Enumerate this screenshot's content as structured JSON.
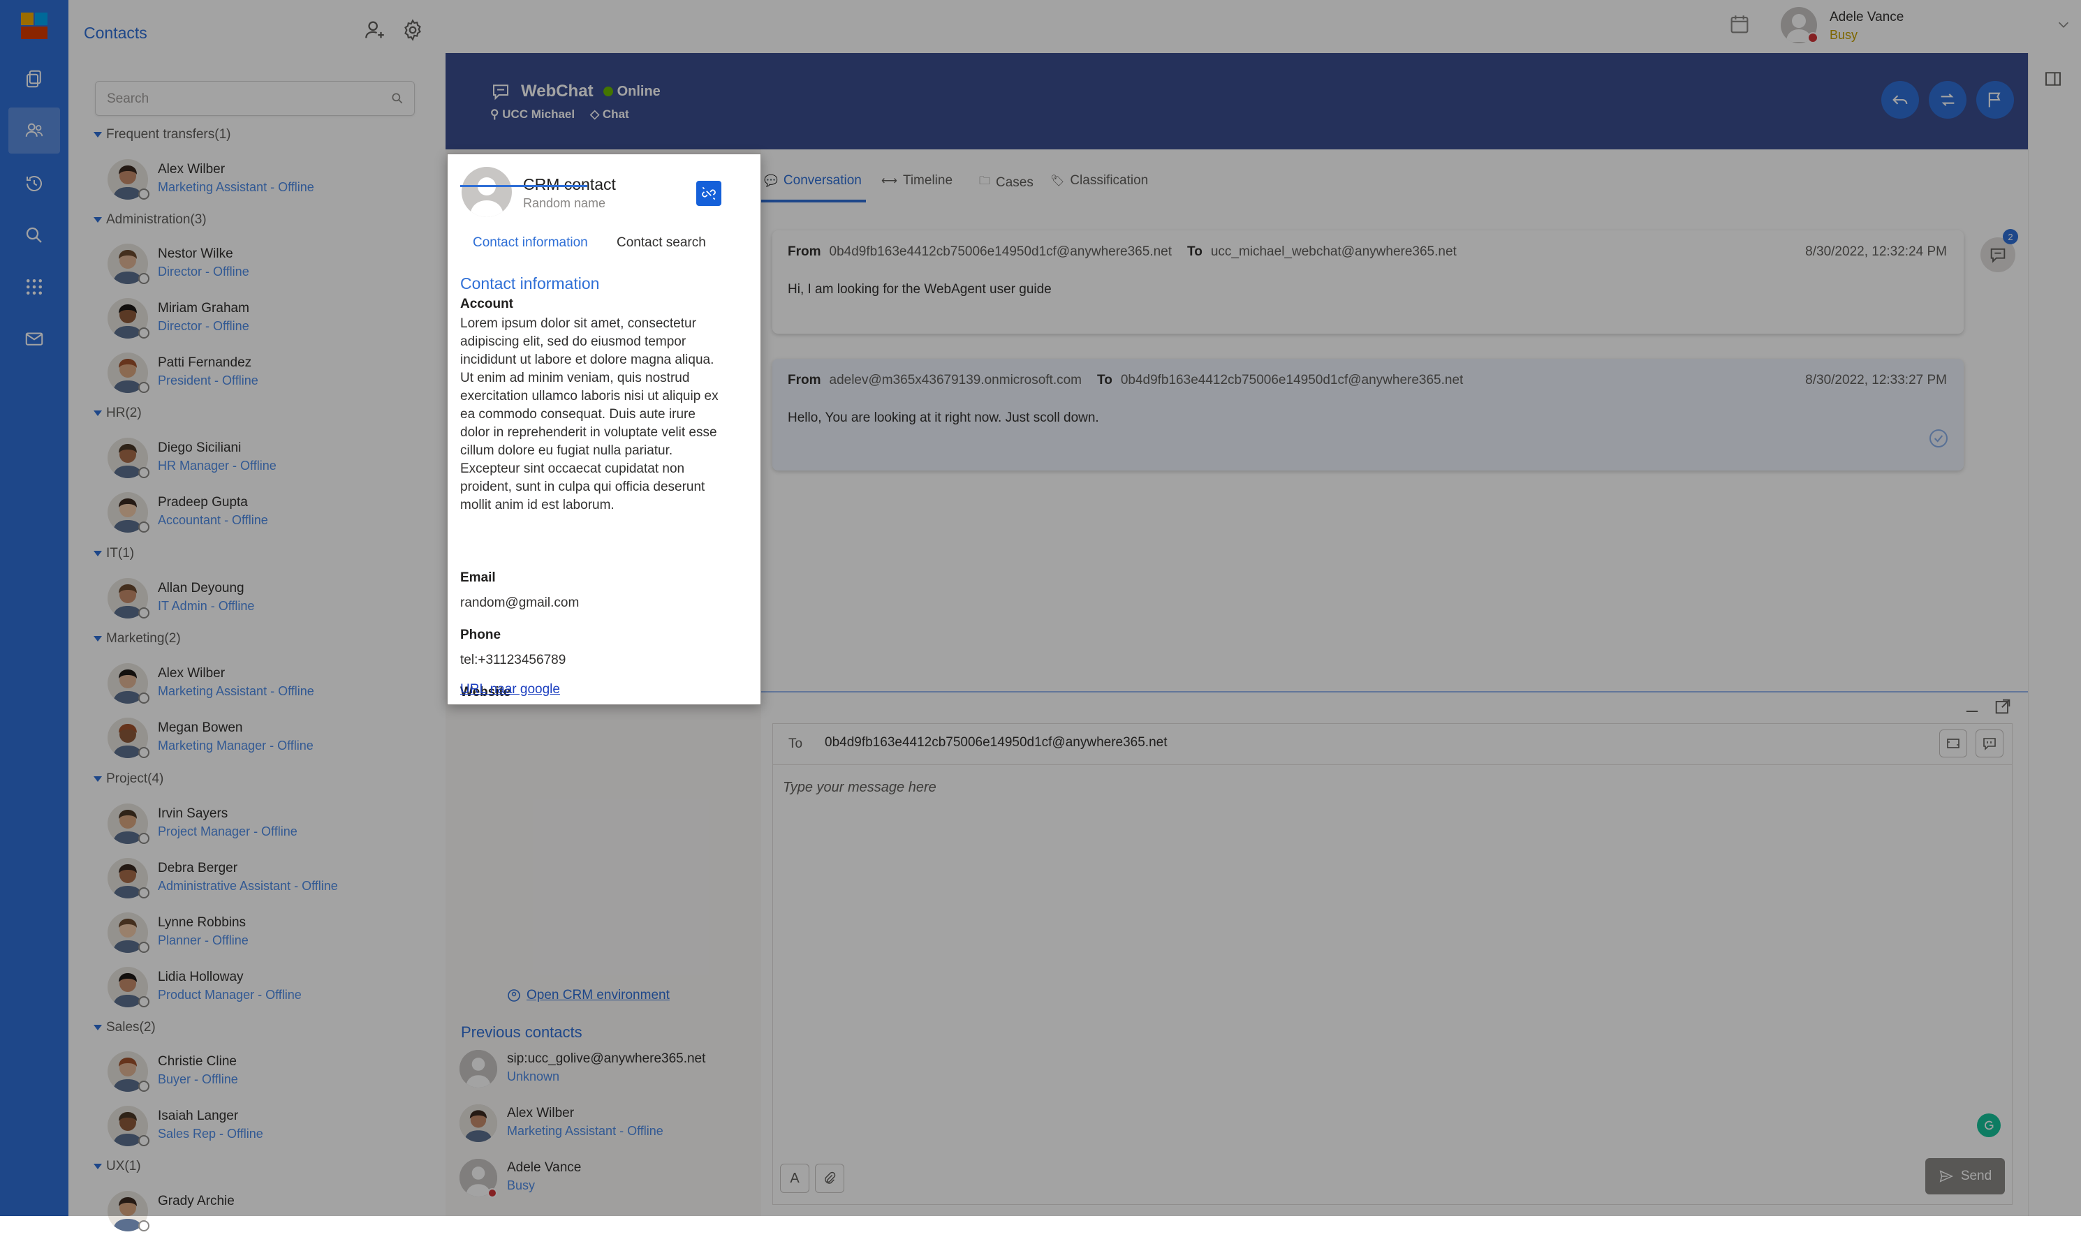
{
  "colors": {
    "brand": "#2f6fd6",
    "banner": "#3a4d8f",
    "online": "#6bb700",
    "busy": "#d13438"
  },
  "app": {
    "title": "Contacts"
  },
  "search": {
    "placeholder": "Search"
  },
  "groups": [
    {
      "label": "Frequent transfers(1)",
      "contacts": [
        {
          "name": "Alex Wilber",
          "sub": "Marketing Assistant - Offline"
        }
      ]
    },
    {
      "label": "Administration(3)",
      "contacts": [
        {
          "name": "Nestor Wilke",
          "sub": "Director - Offline"
        },
        {
          "name": "Miriam Graham",
          "sub": "Director - Offline"
        },
        {
          "name": "Patti Fernandez",
          "sub": "President - Offline"
        }
      ]
    },
    {
      "label": "HR(2)",
      "contacts": [
        {
          "name": "Diego Siciliani",
          "sub": "HR Manager - Offline"
        },
        {
          "name": "Pradeep Gupta",
          "sub": "Accountant - Offline"
        }
      ]
    },
    {
      "label": "IT(1)",
      "contacts": [
        {
          "name": "Allan Deyoung",
          "sub": "IT Admin - Offline"
        }
      ]
    },
    {
      "label": "Marketing(2)",
      "contacts": [
        {
          "name": "Alex Wilber",
          "sub": "Marketing Assistant - Offline"
        },
        {
          "name": "Megan Bowen",
          "sub": "Marketing Manager - Offline"
        }
      ]
    },
    {
      "label": "Project(4)",
      "contacts": [
        {
          "name": "Irvin Sayers",
          "sub": "Project Manager - Offline"
        },
        {
          "name": "Debra Berger",
          "sub": "Administrative Assistant - Offline"
        },
        {
          "name": "Lynne Robbins",
          "sub": "Planner - Offline"
        },
        {
          "name": "Lidia Holloway",
          "sub": "Product Manager - Offline"
        }
      ]
    },
    {
      "label": "Sales(2)",
      "contacts": [
        {
          "name": "Christie Cline",
          "sub": "Buyer - Offline"
        },
        {
          "name": "Isaiah Langer",
          "sub": "Sales Rep - Offline"
        }
      ]
    },
    {
      "label": "UX(1)",
      "contacts": [
        {
          "name": "Grady Archie",
          "sub": ""
        }
      ]
    }
  ],
  "user": {
    "name": "Adele Vance",
    "status": "Busy"
  },
  "banner": {
    "channel": "WebChat",
    "status": "Online",
    "agent": "UCC Michael",
    "type": "Chat"
  },
  "tabs": [
    "Conversation",
    "Timeline",
    "Cases",
    "Classification"
  ],
  "notification_count": "2",
  "messages": [
    {
      "from_label": "From",
      "from": "0b4d9fb163e4412cb75006e14950d1cf@anywhere365.net",
      "to_label": "To",
      "to": "ucc_michael_webchat@anywhere365.net",
      "time": "8/30/2022, 12:32:24 PM",
      "body": "Hi, I am looking for the WebAgent user guide"
    },
    {
      "from_label": "From",
      "from": "adelev@m365x43679139.onmicrosoft.com",
      "to_label": "To",
      "to": "0b4d9fb163e4412cb75006e14950d1cf@anywhere365.net",
      "time": "8/30/2022, 12:33:27 PM",
      "body": "Hello, You are looking at it right now. Just scoll down."
    }
  ],
  "composer": {
    "to_label": "To",
    "to": "0b4d9fb163e4412cb75006e14950d1cf@anywhere365.net",
    "placeholder": "Type your message here",
    "format_label": "A",
    "send_label": "Send"
  },
  "crm_card": {
    "title": "CRM contact",
    "subtitle": "Random name",
    "tab_info": "Contact information",
    "tab_search": "Contact search",
    "section_title": "Contact information",
    "account_label": "Account",
    "account_text": "Lorem ipsum dolor sit amet, consectetur adipiscing elit, sed do eiusmod tempor incididunt ut labore et dolore magna aliqua. Ut enim ad minim veniam, quis nostrud exercitation ullamco laboris nisi ut aliquip ex ea commodo consequat. Duis aute irure dolor in reprehenderit in voluptate velit esse cillum dolore eu fugiat nulla pariatur. Excepteur sint occaecat cupidatat non proident, sunt in culpa qui officia deserunt mollit anim id est laborum.",
    "email_label": "Email",
    "email": "random@gmail.com",
    "phone_label": "Phone",
    "phone": "tel:+31123456789",
    "website_label": "Website",
    "website": "URL naar google"
  },
  "crm_link": "Open CRM environment",
  "previous_title": "Previous contacts",
  "previous_contacts": [
    {
      "name": "sip:ucc_golive@anywhere365.net",
      "sub": "Unknown"
    },
    {
      "name": "Alex Wilber",
      "sub": "Marketing Assistant - Offline"
    },
    {
      "name": "Adele Vance",
      "sub": "Busy"
    }
  ]
}
